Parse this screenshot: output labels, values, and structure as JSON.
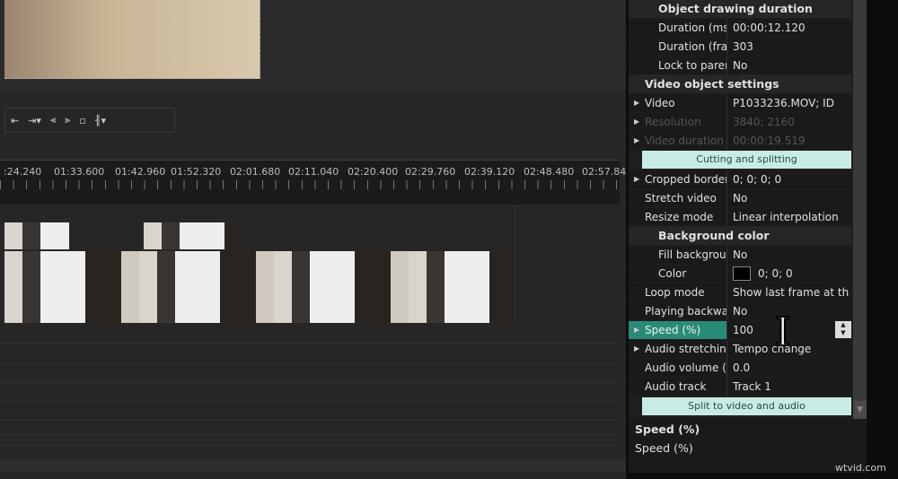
{
  "timeline": {
    "ticks": [
      ":24.240",
      "01:33.600",
      "01:42.960",
      "01:52.320",
      "02:01.680",
      "02:11.040",
      "02:20.400",
      "02:29.760",
      "02:39.120",
      "02:48.480",
      "02:57.84"
    ]
  },
  "toolbar": {
    "icons": [
      "go-start-icon",
      "go-end-icon",
      "align-left-icon",
      "align-right-icon",
      "distribute-icon",
      "split-icon"
    ]
  },
  "props": {
    "drawing_header": "Object drawing duration",
    "duration_ms": {
      "k": "Duration (ms)",
      "v": "00:00:12.120"
    },
    "duration_frames": {
      "k": "Duration (frame",
      "v": "303"
    },
    "lock_parent": {
      "k": "Lock to parent c",
      "v": "No"
    },
    "video_header": "Video object settings",
    "video": {
      "k": "Video",
      "v": "P1033236.MOV; ID"
    },
    "resolution": {
      "k": "Resolution",
      "v": "3840; 2160"
    },
    "video_duration": {
      "k": "Video duration",
      "v": "00:00:19.519"
    },
    "cutting_btn": "Cutting and splitting",
    "cropped": {
      "k": "Cropped borders",
      "v": "0; 0; 0; 0"
    },
    "stretch": {
      "k": "Stretch video",
      "v": "No"
    },
    "resize": {
      "k": "Resize mode",
      "v": "Linear interpolation"
    },
    "bg_header": "Background color",
    "fill_bg": {
      "k": "Fill background",
      "v": "No"
    },
    "color": {
      "k": "Color",
      "v": "0; 0; 0",
      "swatch": "#000000"
    },
    "loop": {
      "k": "Loop mode",
      "v": "Show last frame at th"
    },
    "backwards": {
      "k": "Playing backwards",
      "v": "No"
    },
    "speed": {
      "k": "Speed (%)",
      "v": "100"
    },
    "audio_stretch": {
      "k": "Audio stretching m",
      "v": "Tempo change"
    },
    "audio_volume": {
      "k": "Audio volume (dB)",
      "v": "0.0"
    },
    "audio_track": {
      "k": "Audio track",
      "v": "Track 1"
    },
    "split_btn": "Split to video and audio"
  },
  "help": {
    "title": "Speed (%)",
    "text": "Speed (%)"
  },
  "colors": {
    "accent": "#2a8a78",
    "button": "#c8ece4"
  },
  "watermark": "wtvid.com"
}
